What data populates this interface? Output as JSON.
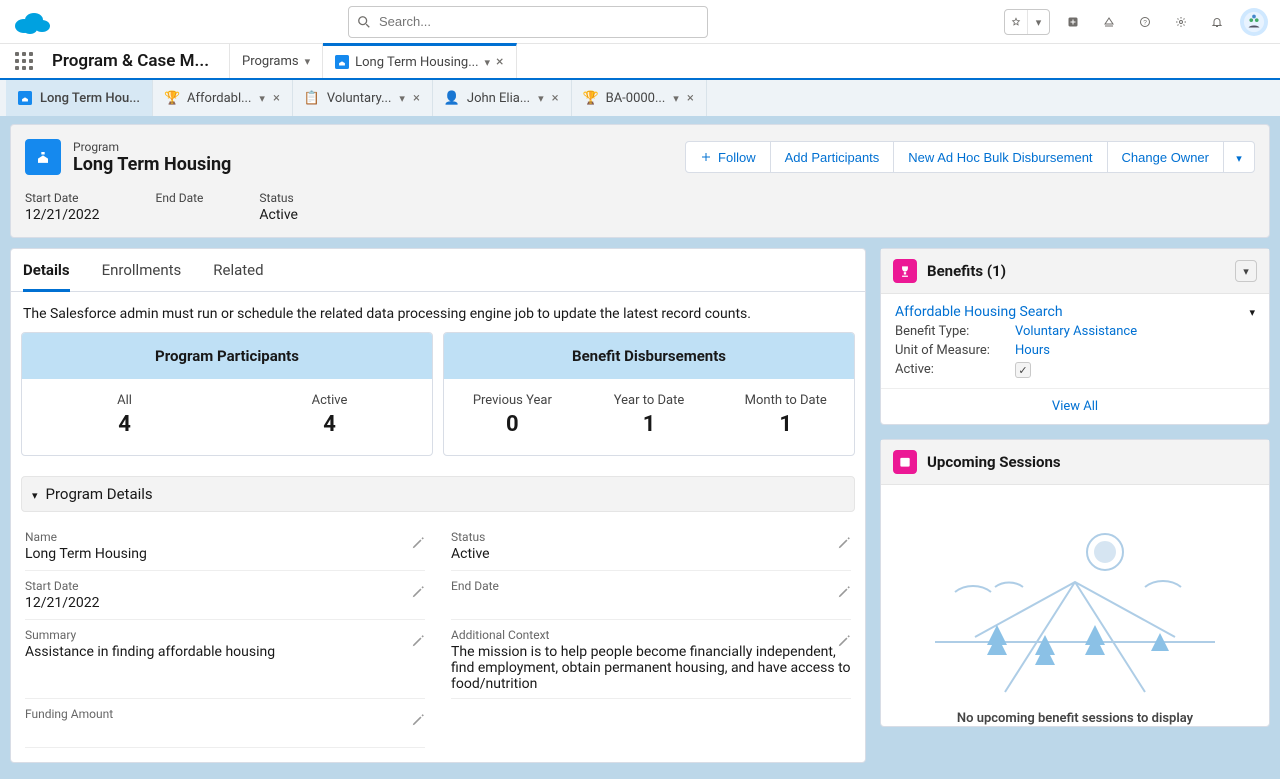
{
  "search": {
    "placeholder": "Search..."
  },
  "app_name": "Program & Case M...",
  "nav_tabs": [
    {
      "label": "Programs",
      "closable": false,
      "icon": null
    },
    {
      "label": "Long Term Housing...",
      "closable": true,
      "icon": "program",
      "active": true
    }
  ],
  "workspace_tabs": [
    {
      "label": "Long Term Hou...",
      "icon": "program",
      "active": true,
      "closable": false
    },
    {
      "label": "Affordabl...",
      "icon": "trophy",
      "closable": true
    },
    {
      "label": "Voluntary...",
      "icon": "clipboard",
      "closable": true
    },
    {
      "label": "John Elia...",
      "icon": "person",
      "closable": true
    },
    {
      "label": "BA-0000...",
      "icon": "trophy",
      "closable": true
    }
  ],
  "record": {
    "eyebrow": "Program",
    "title": "Long Term Housing",
    "actions": {
      "follow": "Follow",
      "add_participants": "Add Participants",
      "new_disbursement": "New Ad Hoc Bulk Disbursement",
      "change_owner": "Change Owner"
    },
    "highlights": {
      "start_date": {
        "label": "Start Date",
        "value": "12/21/2022"
      },
      "end_date": {
        "label": "End Date",
        "value": ""
      },
      "status": {
        "label": "Status",
        "value": "Active"
      }
    }
  },
  "detail_tabs": {
    "details": "Details",
    "enrollments": "Enrollments",
    "related": "Related"
  },
  "notice": "The Salesforce admin must run or schedule the related data processing engine job to update the latest record counts.",
  "metrics": {
    "participants": {
      "title": "Program Participants",
      "all": {
        "label": "All",
        "value": "4"
      },
      "active": {
        "label": "Active",
        "value": "4"
      }
    },
    "disbursements": {
      "title": "Benefit Disbursements",
      "prev_year": {
        "label": "Previous Year",
        "value": "0"
      },
      "ytd": {
        "label": "Year to Date",
        "value": "1"
      },
      "mtd": {
        "label": "Month to Date",
        "value": "1"
      }
    }
  },
  "section_title": "Program Details",
  "fields": {
    "name": {
      "label": "Name",
      "value": "Long Term Housing"
    },
    "status": {
      "label": "Status",
      "value": "Active"
    },
    "start": {
      "label": "Start Date",
      "value": "12/21/2022"
    },
    "end": {
      "label": "End Date",
      "value": ""
    },
    "summary": {
      "label": "Summary",
      "value": "Assistance in finding affordable housing"
    },
    "context": {
      "label": "Additional Context",
      "value": "The mission is to help people become financially independent, find employment, obtain permanent housing, and have access to food/nutrition"
    },
    "funding": {
      "label": "Funding Amount",
      "value": ""
    }
  },
  "benefits_card": {
    "title": "Benefits (1)",
    "item": {
      "name": "Affordable Housing Search",
      "type_label": "Benefit Type:",
      "type_value": "Voluntary Assistance",
      "uom_label": "Unit of Measure:",
      "uom_value": "Hours",
      "active_label": "Active:"
    },
    "view_all": "View All"
  },
  "sessions_card": {
    "title": "Upcoming Sessions",
    "empty": "No upcoming benefit sessions to display"
  }
}
